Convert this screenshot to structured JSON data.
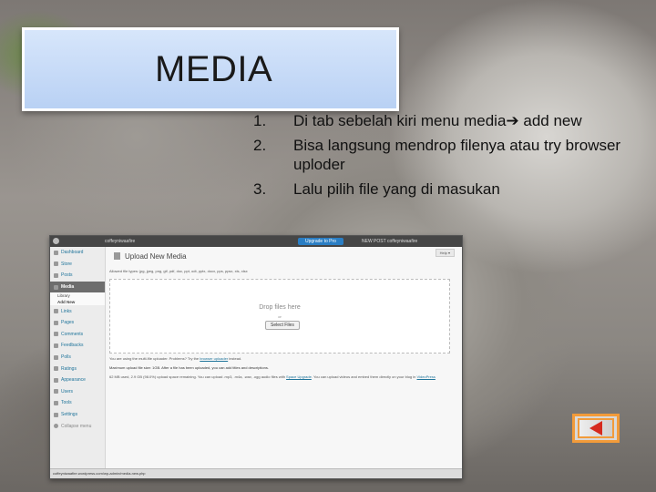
{
  "slide": {
    "title": "MEDIA",
    "bullets": [
      {
        "num": "1.",
        "text_before": "Di tab sebelah kiri menu media",
        "arrow": "➔",
        "text_after": " add new"
      },
      {
        "num": "2.",
        "text": "Bisa langsung mendrop filenya atau try browser uploder"
      },
      {
        "num": "3.",
        "text": "Lalu pilih file yang di masukan"
      }
    ]
  },
  "wp": {
    "adminbar": {
      "site": "coffeyniwaafire",
      "upgrade": "Upgrade to Pro",
      "new_post": "NEW POST",
      "user": "coffeyniwaafire"
    },
    "sidebar": {
      "items": [
        {
          "label": "Dashboard",
          "icon": "dashboard-icon"
        },
        {
          "label": "Store",
          "icon": "store-icon"
        },
        {
          "label": "Posts",
          "icon": "posts-icon"
        },
        {
          "label": "Media",
          "icon": "media-icon",
          "active": true
        },
        {
          "label": "Links",
          "icon": "links-icon"
        },
        {
          "label": "Pages",
          "icon": "pages-icon"
        },
        {
          "label": "Comments",
          "icon": "comments-icon"
        },
        {
          "label": "Feedbacks",
          "icon": "feedbacks-icon"
        },
        {
          "label": "Polls",
          "icon": "polls-icon"
        },
        {
          "label": "Ratings",
          "icon": "ratings-icon"
        },
        {
          "label": "Appearance",
          "icon": "appearance-icon"
        },
        {
          "label": "Users",
          "icon": "users-icon"
        },
        {
          "label": "Tools",
          "icon": "tools-icon"
        },
        {
          "label": "Settings",
          "icon": "settings-icon"
        }
      ],
      "media_sub": [
        "Library",
        "Add New"
      ],
      "collapse": "Collapse menu"
    },
    "page_title": "Upload New Media",
    "help": "Help ▾",
    "allowed": "Allowed file types: jpg, jpeg, png, gif, pdf, doc, ppt, odt, pptx, docx, pps, ppsx, xls, xlsx",
    "drop_text": "Drop files here",
    "drop_or": "or",
    "select_btn": "Select Files",
    "uploader_note": "You are using the multi-file uploader. Problems? Try the ",
    "uploader_link": "browser uploader",
    "uploader_end": " instead.",
    "max_size": "Maximum upload file size: 1GB. After a file has been uploaded, you can add titles and descriptions.",
    "space_note": "62 MB used, 2.9 GB (98.0%) upload space remaining. You can upload .mp3, .m4a, .wav, .ogg audio files with ",
    "space_link": "Space Upgrade",
    "space_end": ". You can upload videos and embed them directly on your blog in ",
    "video_link": "VideoPress",
    "statusbar": "coffeyniwaafire.wordpress.com/wp-admin/media-new.php"
  },
  "nav": {
    "back_icon": "back-arrow-icon"
  }
}
